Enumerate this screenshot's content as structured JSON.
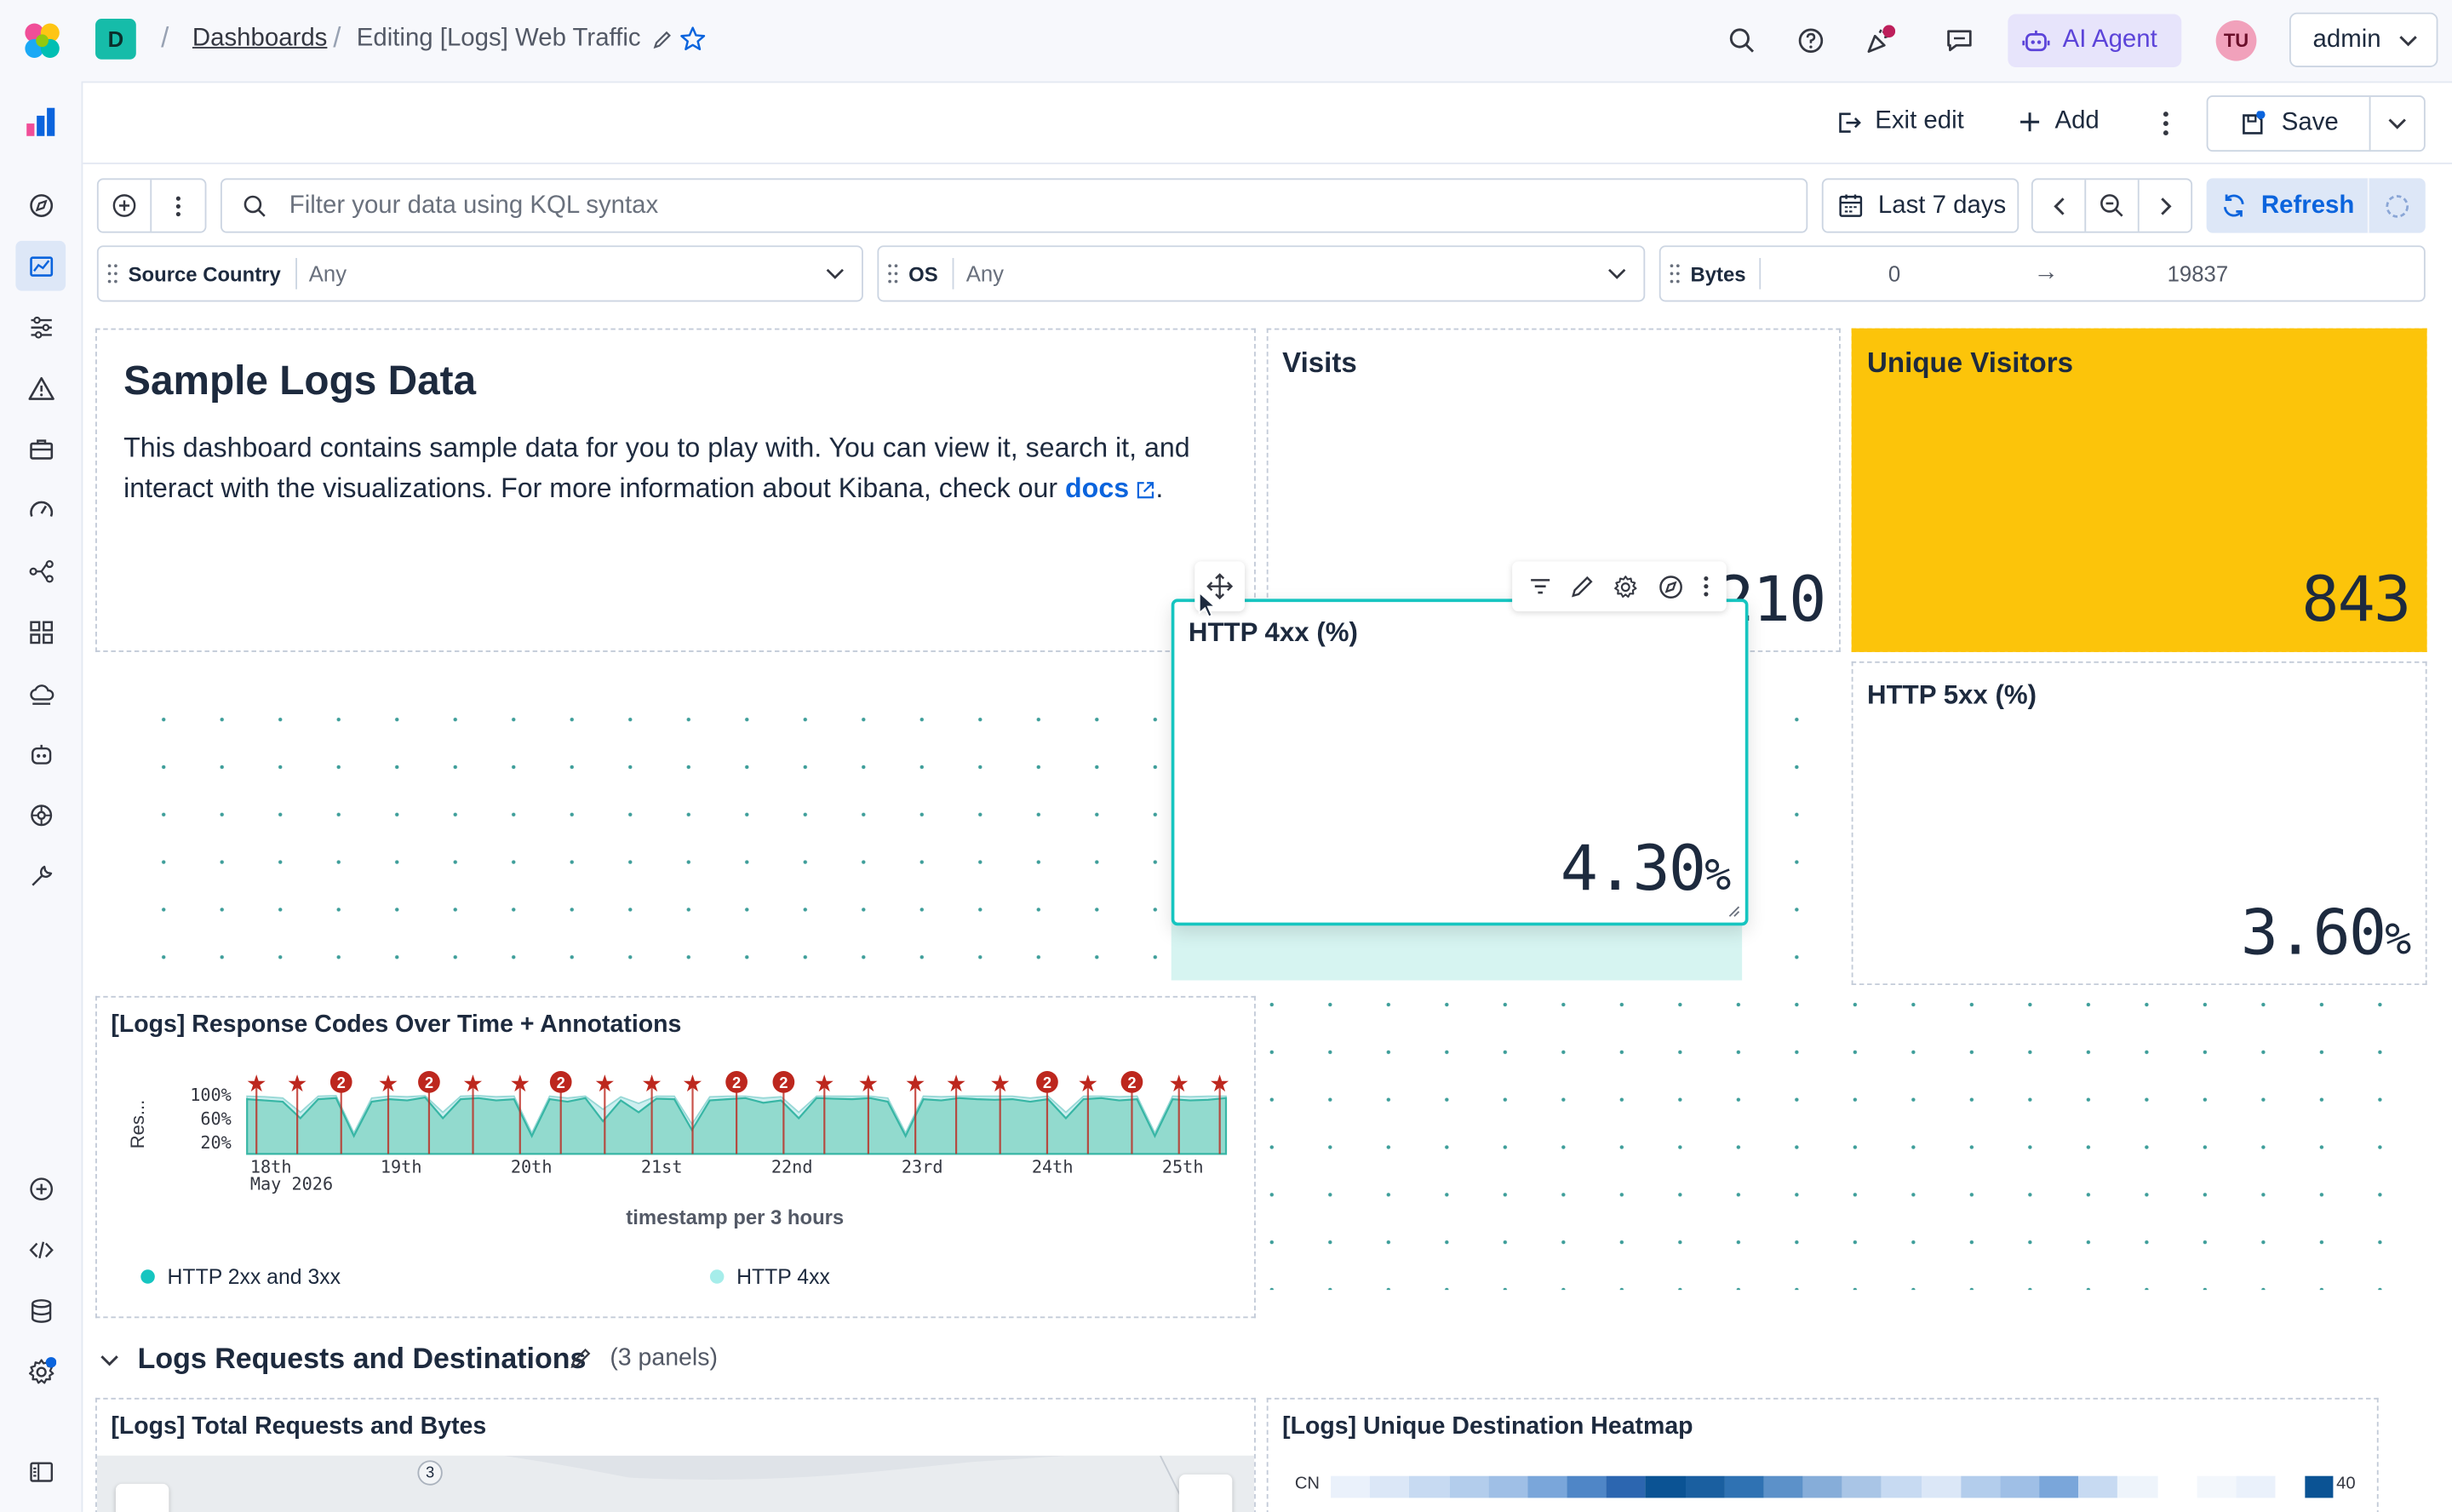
{
  "app": {
    "space_letter": "D"
  },
  "breadcrumb": {
    "parent": "Dashboards",
    "current": "Editing [Logs] Web Traffic"
  },
  "header": {
    "ai_agent_label": "AI Agent",
    "avatar_initials": "TU",
    "user_menu": "admin"
  },
  "toolbar": {
    "exit_edit": "Exit edit",
    "add": "Add",
    "save": "Save"
  },
  "query": {
    "placeholder": "Filter your data using KQL syntax",
    "time_range": "Last 7 days",
    "refresh": "Refresh"
  },
  "controls": [
    {
      "label": "Source Country",
      "value": "Any"
    },
    {
      "label": "OS",
      "value": "Any"
    },
    {
      "label": "Bytes",
      "min": "0",
      "arrow": "→",
      "max": "19837"
    }
  ],
  "markdown_panel": {
    "title": "Sample Logs Data",
    "body": "This dashboard contains sample data for you to play with. You can view it, search it, and interact with the visualizations. For more information about Kibana, check our",
    "link": "docs",
    "tail": "."
  },
  "metrics": {
    "visits": {
      "title": "Visits",
      "value_visible": "210"
    },
    "unique_visitors": {
      "title": "Unique Visitors",
      "value": "843",
      "color": "#fcc40a"
    },
    "http4xx": {
      "title": "HTTP 4xx (%)",
      "value": "4.30",
      "unit": "%"
    },
    "http5xx": {
      "title": "HTTP 5xx (%)",
      "value": "3.60",
      "unit": "%"
    }
  },
  "response_codes_panel": {
    "title": "[Logs] Response Codes Over Time + Annotations",
    "legend": [
      "HTTP 2xx and 3xx",
      "HTTP 4xx"
    ]
  },
  "section": {
    "title": "Logs Requests and Destinations",
    "count": "(3 panels)"
  },
  "bottom_panels": {
    "requests": {
      "title": "[Logs] Total Requests and Bytes",
      "cluster": "3"
    },
    "heatmap": {
      "title": "[Logs] Unique Destination Heatmap",
      "row_label": "CN",
      "legend_max": "40"
    }
  },
  "colors": {
    "accent": "#0b64dd",
    "teal": "#16c5c0",
    "annotation": "#bd271e",
    "border": "#ccd5e2"
  },
  "chart_data": {
    "type": "area",
    "title": "[Logs] Response Codes Over Time + Annotations",
    "ylabel": "Res...",
    "xlabel": "timestamp per 3 hours",
    "x_ticks": [
      "18th",
      "19th",
      "20th",
      "21st",
      "22nd",
      "23rd",
      "24th",
      "25th"
    ],
    "x_subtick": "May 2026",
    "y_ticks": [
      "100%",
      "60%",
      "20%"
    ],
    "ylim": [
      0,
      100
    ],
    "stacked_percent": true,
    "legend_position": "bottom",
    "series": [
      {
        "name": "HTTP 2xx and 3xx",
        "color": "#54b399",
        "values": [
          92,
          90,
          88,
          60,
          92,
          94,
          30,
          88,
          92,
          90,
          95,
          60,
          92,
          94,
          90,
          92,
          30,
          92,
          88,
          94,
          55,
          90,
          70,
          93,
          92,
          40,
          90,
          92,
          94,
          86,
          90,
          60,
          94,
          93,
          92,
          94,
          88,
          30,
          92,
          90,
          94,
          92,
          91,
          92,
          88,
          92,
          60,
          92,
          94,
          90,
          92,
          30,
          92,
          90,
          91,
          94
        ]
      },
      {
        "name": "HTTP 4xx",
        "color": "#a6edea",
        "values": [
          5,
          6,
          6,
          10,
          5,
          4,
          5,
          6,
          5,
          6,
          3,
          10,
          5,
          4,
          6,
          5,
          5,
          5,
          6,
          3,
          20,
          6,
          15,
          4,
          5,
          10,
          6,
          5,
          3,
          8,
          6,
          10,
          3,
          4,
          5,
          3,
          6,
          5,
          5,
          6,
          3,
          5,
          6,
          5,
          6,
          5,
          10,
          5,
          3,
          6,
          5,
          5,
          5,
          6,
          6,
          3
        ]
      }
    ],
    "annotations": [
      {
        "label": "★"
      },
      {
        "label": "★"
      },
      {
        "label": "2"
      },
      {
        "label": "★"
      },
      {
        "label": "2"
      },
      {
        "label": "★"
      },
      {
        "label": "★"
      },
      {
        "label": "2"
      },
      {
        "label": "★"
      },
      {
        "label": "★"
      },
      {
        "label": "★"
      },
      {
        "label": "2"
      },
      {
        "label": "2"
      },
      {
        "label": "★"
      },
      {
        "label": "★"
      },
      {
        "label": "★"
      },
      {
        "label": "★"
      },
      {
        "label": "★"
      },
      {
        "label": "2"
      },
      {
        "label": "★"
      },
      {
        "label": "2"
      },
      {
        "label": "★"
      },
      {
        "label": "★"
      }
    ]
  }
}
